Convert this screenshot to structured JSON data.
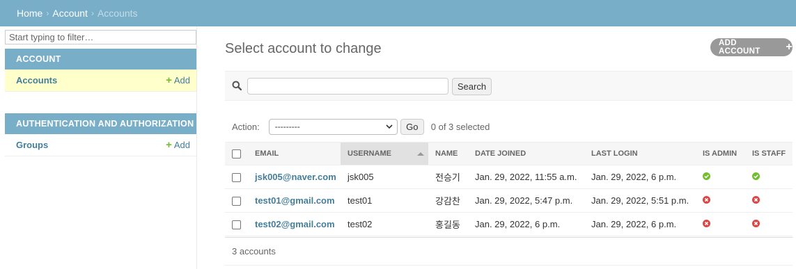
{
  "breadcrumb": {
    "home": "Home",
    "app": "Account",
    "current": "Accounts",
    "separator": "›"
  },
  "sidebar": {
    "filter_placeholder": "Start typing to filter…",
    "modules": [
      {
        "caption": "ACCOUNT",
        "model": "Accounts",
        "add": "Add"
      },
      {
        "caption": "AUTHENTICATION AND AUTHORIZATION",
        "model": "Groups",
        "add": "Add"
      }
    ]
  },
  "main": {
    "title": "Select account to change",
    "add_button": "ADD ACCOUNT",
    "search_button": "Search",
    "actions_label": "Action:",
    "action_selected": "---------",
    "go_button": "Go",
    "selection_counter": "0 of 3 selected",
    "columns": [
      "EMAIL",
      "USERNAME",
      "NAME",
      "DATE JOINED",
      "LAST LOGIN",
      "IS ADMIN",
      "IS STAFF"
    ],
    "rows": [
      {
        "email": "jsk005@naver.com",
        "username": "jsk005",
        "name": "전승기",
        "date_joined": "Jan. 29, 2022, 11:55 a.m.",
        "last_login": "Jan. 29, 2022, 6 p.m.",
        "is_admin": "yes-icon",
        "is_staff": "yes-icon"
      },
      {
        "email": "test01@gmail.com",
        "username": "test01",
        "name": "강감찬",
        "date_joined": "Jan. 29, 2022, 5:47 p.m.",
        "last_login": "Jan. 29, 2022, 5:51 p.m.",
        "is_admin": "no-icon",
        "is_staff": "no-icon"
      },
      {
        "email": "test02@gmail.com",
        "username": "test02",
        "name": "홍길동",
        "date_joined": "Jan. 29, 2022, 6 p.m.",
        "last_login": "Jan. 29, 2022, 6 p.m.",
        "is_admin": "no-icon",
        "is_staff": "no-icon"
      }
    ],
    "paginator": "3 accounts"
  },
  "colors": {
    "header": "#79aec8",
    "link": "#447e9b",
    "add_green": "#70bf2b",
    "yes": "#70bf2b",
    "no": "#dd4646"
  }
}
